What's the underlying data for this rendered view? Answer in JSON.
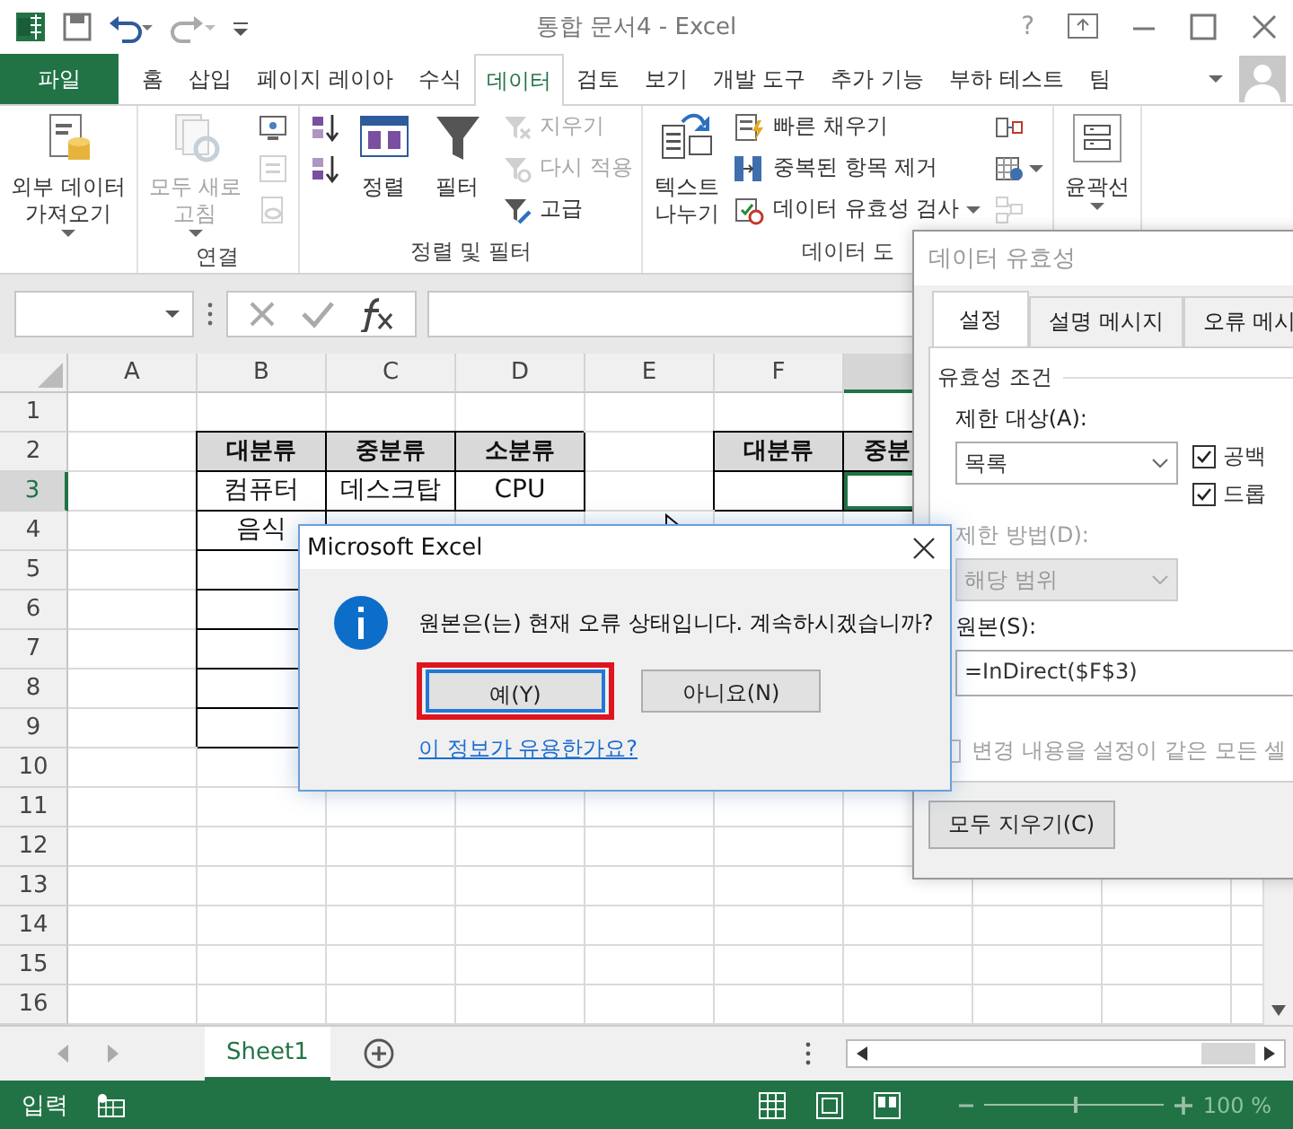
{
  "window": {
    "title": "통합 문서4 - Excel",
    "help_button": "?"
  },
  "tabs": [
    {
      "label": "파일",
      "kind": "file",
      "selected": false
    },
    {
      "label": "홈",
      "kind": "tab",
      "selected": false
    },
    {
      "label": "삽입",
      "kind": "tab",
      "selected": false
    },
    {
      "label": "페이지 레이아",
      "kind": "tab",
      "selected": false
    },
    {
      "label": "수식",
      "kind": "tab",
      "selected": false
    },
    {
      "label": "데이터",
      "kind": "tab",
      "selected": true
    },
    {
      "label": "검토",
      "kind": "tab",
      "selected": false
    },
    {
      "label": "보기",
      "kind": "tab",
      "selected": false
    },
    {
      "label": "개발 도구",
      "kind": "tab",
      "selected": false
    },
    {
      "label": "추가 기능",
      "kind": "tab",
      "selected": false
    },
    {
      "label": "부하 테스트",
      "kind": "tab",
      "selected": false
    },
    {
      "label": "팀",
      "kind": "tab",
      "selected": false
    }
  ],
  "ribbon": {
    "groups": [
      {
        "items": [
          {
            "kind": "large",
            "lines": [
              "외부 데이터",
              "가져오기"
            ],
            "dropdown": true,
            "disabled": false
          }
        ]
      },
      {
        "label": "연결",
        "items": [
          {
            "kind": "large",
            "lines": [
              "모두 새로",
              "고침"
            ],
            "dropdown": true,
            "disabled": true
          },
          {
            "kind": "stack",
            "items": [
              {
                "disabled": false
              },
              {
                "disabled": true
              },
              {
                "disabled": true
              }
            ]
          }
        ]
      },
      {
        "label": "정렬 및 필터",
        "items": [
          {
            "kind": "stack",
            "items": [
              {
                "disabled": false
              },
              {
                "disabled": false
              }
            ]
          },
          {
            "kind": "large",
            "lines": [
              "정렬"
            ],
            "dropdown": false,
            "disabled": false
          },
          {
            "kind": "large",
            "lines": [
              "필터"
            ],
            "dropdown": false,
            "disabled": false
          },
          {
            "kind": "stack",
            "items": [
              {
                "label": "지우기",
                "disabled": true
              },
              {
                "label": "다시 적용",
                "disabled": true
              },
              {
                "label": "고급",
                "disabled": false
              }
            ]
          }
        ]
      },
      {
        "label": "데이터 도",
        "items": [
          {
            "kind": "large",
            "lines": [
              "텍스트",
              "나누기"
            ],
            "dropdown": false,
            "disabled": false
          },
          {
            "kind": "stack",
            "items": [
              {
                "label": "빠른 채우기",
                "disabled": false
              },
              {
                "label": "중복된 항목 제거",
                "disabled": false
              },
              {
                "label": "데이터 유효성 검사",
                "disabled": false,
                "dropdown": true
              }
            ]
          },
          {
            "kind": "stack",
            "items": [
              {
                "disabled": false
              },
              {
                "disabled": false,
                "dropdown": true
              },
              {
                "disabled": true
              }
            ]
          }
        ]
      },
      {
        "items": [
          {
            "kind": "large",
            "lines": [
              "윤곽선"
            ],
            "dropdown": true,
            "disabled": false
          }
        ]
      }
    ]
  },
  "sheet": {
    "columns": [
      {
        "label": "A",
        "selected": false
      },
      {
        "label": "B",
        "selected": false
      },
      {
        "label": "C",
        "selected": false
      },
      {
        "label": "D",
        "selected": false
      },
      {
        "label": "E",
        "selected": false
      },
      {
        "label": "F",
        "selected": false
      },
      {
        "selected": true
      }
    ],
    "rows": [
      {
        "header": "1",
        "selected": false
      },
      {
        "header": "2",
        "selected": false,
        "cells": [
          {
            "bordered": false
          },
          {
            "bordered": true,
            "kind": "header",
            "text": "대분류"
          },
          {
            "bordered": true,
            "kind": "header",
            "text": "중분류"
          },
          {
            "bordered": true,
            "kind": "header",
            "text": "소분류"
          },
          {
            "bordered": false
          },
          {
            "bordered": true,
            "kind": "header",
            "text": "대분류"
          },
          {
            "bordered": true,
            "kind": "header",
            "text": "중분"
          }
        ]
      },
      {
        "header": "3",
        "selected": true,
        "cells": [
          {
            "bordered": false
          },
          {
            "bordered": true,
            "text": "컴퓨터"
          },
          {
            "bordered": true,
            "text": "데스크탑"
          },
          {
            "bordered": true,
            "text": "CPU"
          },
          {
            "bordered": false
          },
          {
            "bordered": true
          },
          {
            "bordered": true
          }
        ]
      },
      {
        "header": "4",
        "selected": false,
        "cells": [
          {
            "bordered": false
          },
          {
            "bordered": true,
            "text": "음식"
          }
        ]
      },
      {
        "header": "5",
        "selected": false,
        "cells": [
          {
            "bordered": false
          },
          {
            "bordered": true
          }
        ]
      },
      {
        "header": "6",
        "selected": false,
        "cells": [
          {
            "bordered": false
          },
          {
            "bordered": true
          }
        ]
      },
      {
        "header": "7",
        "selected": false,
        "cells": [
          {
            "bordered": false
          },
          {
            "bordered": true
          }
        ]
      },
      {
        "header": "8",
        "selected": false,
        "cells": [
          {
            "bordered": false
          },
          {
            "bordered": true
          }
        ]
      },
      {
        "header": "9",
        "selected": false,
        "cells": [
          {
            "bordered": false
          },
          {
            "bordered": true
          }
        ]
      },
      {
        "header": "10",
        "selected": false
      },
      {
        "header": "11",
        "selected": false
      },
      {
        "header": "12",
        "selected": false
      },
      {
        "header": "13",
        "selected": false
      },
      {
        "header": "14",
        "selected": false
      },
      {
        "header": "15",
        "selected": false
      },
      {
        "header": "16",
        "selected": false
      }
    ]
  },
  "sheet_tabs": [
    {
      "label": "Sheet1",
      "selected": true
    }
  ],
  "status_bar": {
    "mode": "입력",
    "zoom": {
      "level": 0.5,
      "reading": "100 %"
    }
  },
  "validation_dialog": {
    "title": "데이터 유효성",
    "tabs": [
      {
        "label": "설정",
        "selected": true
      },
      {
        "label": "설명 메시지",
        "selected": false
      },
      {
        "label": "오류 메시",
        "selected": false
      }
    ],
    "section": "유효성 조건",
    "allow_label": "제한 대상(A):",
    "allow_value": "목록",
    "checkboxes": [
      {
        "label": "공백",
        "checked": true
      },
      {
        "label": "드롭",
        "checked": true
      }
    ],
    "data_label": "제한 방법(D):",
    "data_value": "해당 범위",
    "data_disabled": true,
    "source_label": "원본(S):",
    "source_value": "=InDirect($F$3)",
    "apply_all": {
      "label": "변경 내용을 설정이 같은 모든 셀",
      "checked": false,
      "disabled": true
    },
    "clear_button": "모두 지우기(C)"
  },
  "message_box": {
    "title": "Microsoft Excel",
    "message": "원본은(는) 현재 오류 상태입니다. 계속하시겠습니까?",
    "buttons": [
      {
        "label": "예(Y)",
        "focused": true
      },
      {
        "label": "아니요(N)",
        "focused": false
      }
    ],
    "link": "이 정보가 유용한가요?"
  }
}
